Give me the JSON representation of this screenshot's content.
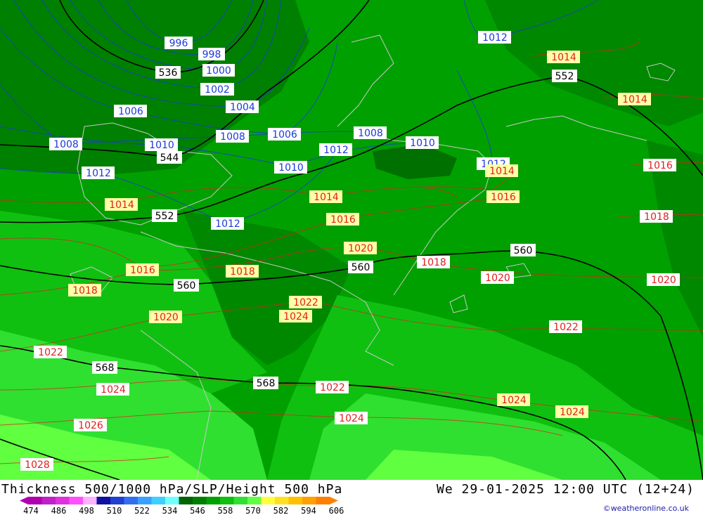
{
  "title": "Thickness 500/1000 hPa/SLP/Height 500 hPa",
  "datetime": "We 29-01-2025 12:00 UTC (12+24)",
  "credit": "©weatheronline.co.uk",
  "legend": {
    "labels": [
      "474",
      "486",
      "498",
      "510",
      "522",
      "534",
      "546",
      "558",
      "570",
      "582",
      "594",
      "606"
    ],
    "colors": [
      "#b000b0",
      "#c020c8",
      "#e030e0",
      "#ff50ff",
      "#ffb0ff",
      "#1010a0",
      "#2040d0",
      "#3070f0",
      "#3aa0ff",
      "#40d0ff",
      "#70ffff",
      "#006400",
      "#008000",
      "#00a000",
      "#10c010",
      "#30e030",
      "#60ff40",
      "#ffff40",
      "#ffe020",
      "#ffc000",
      "#ffa000",
      "#ff8000"
    ]
  },
  "colors": {
    "slp_low": "#1a3ad8",
    "slp_high": "#e02020",
    "height_line": "#000000",
    "coast": "#c8c8c8"
  },
  "isobars_blue": [
    "996",
    "998",
    "1000",
    "1002",
    "1004",
    "1006",
    "1006",
    "1008",
    "1008",
    "1008",
    "1010",
    "1010",
    "1010",
    "1012",
    "1012",
    "1012",
    "1012",
    "1012"
  ],
  "isobars_red": [
    "1014",
    "1014",
    "1014",
    "1014",
    "1014",
    "1016",
    "1016",
    "1016",
    "1016",
    "1018",
    "1018",
    "1018",
    "1018",
    "1020",
    "1020",
    "1020",
    "1020",
    "1022",
    "1022",
    "1022",
    "1022",
    "1024",
    "1024",
    "1024",
    "1024",
    "1024",
    "1026",
    "1028"
  ],
  "heights": [
    "536",
    "544",
    "552",
    "552",
    "560",
    "560",
    "560",
    "568",
    "568"
  ]
}
